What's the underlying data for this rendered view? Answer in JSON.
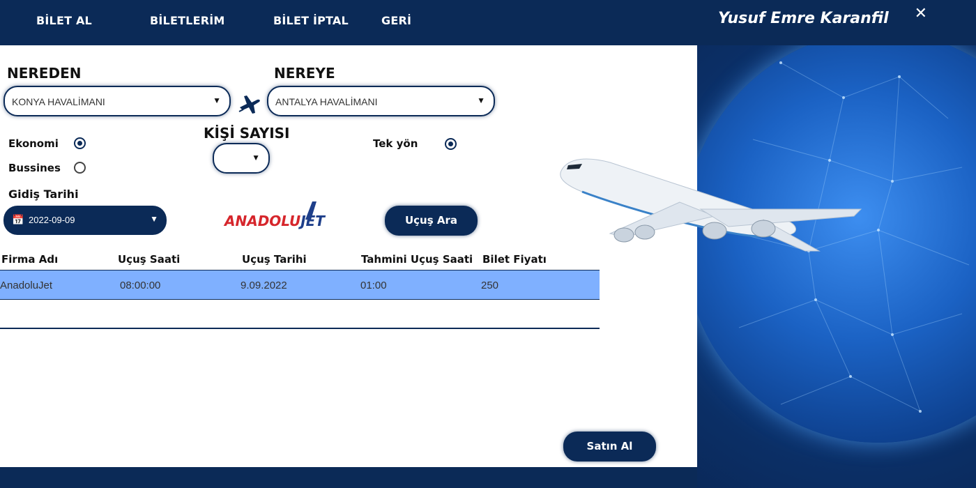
{
  "nav": {
    "items": [
      "BİLET AL",
      "BİLETLERİM",
      "BİLET İPTAL",
      "GERİ"
    ],
    "user_name": "Yusuf Emre Karanfil",
    "close_glyph": "✕"
  },
  "from": {
    "label": "NEREDEN",
    "value": "KONYA HAVALİMANI"
  },
  "to": {
    "label": "NEREYE",
    "value": "ANTALYA HAVALİMANI"
  },
  "class": {
    "economy": "Ekonomi",
    "business": "Bussines",
    "selected": "economy"
  },
  "passengers": {
    "label": "KİŞİ SAYISI",
    "value": ""
  },
  "trip": {
    "one_way": "Tek yön",
    "selected": true
  },
  "departure": {
    "label": "Gidiş Tarihi",
    "value": "2022-09-09"
  },
  "search_button": "Uçuş Ara",
  "logo": {
    "part1": "ANADOLU",
    "part2": "JET"
  },
  "table": {
    "headers": [
      "Firma Adı",
      "Uçuş Saati",
      "Uçuş Tarihi",
      "Tahmini Uçuş Saati",
      "Bilet Fiyatı"
    ],
    "rows": [
      [
        "AnadoluJet",
        "08:00:00",
        "9.09.2022",
        "01:00",
        "250"
      ]
    ]
  },
  "buy_button": "Satın Al",
  "colors": {
    "navy": "#0b2a57",
    "selected_row": "#7fb0ff",
    "logo_red": "#d6262c",
    "logo_blue": "#1e3f8a"
  }
}
